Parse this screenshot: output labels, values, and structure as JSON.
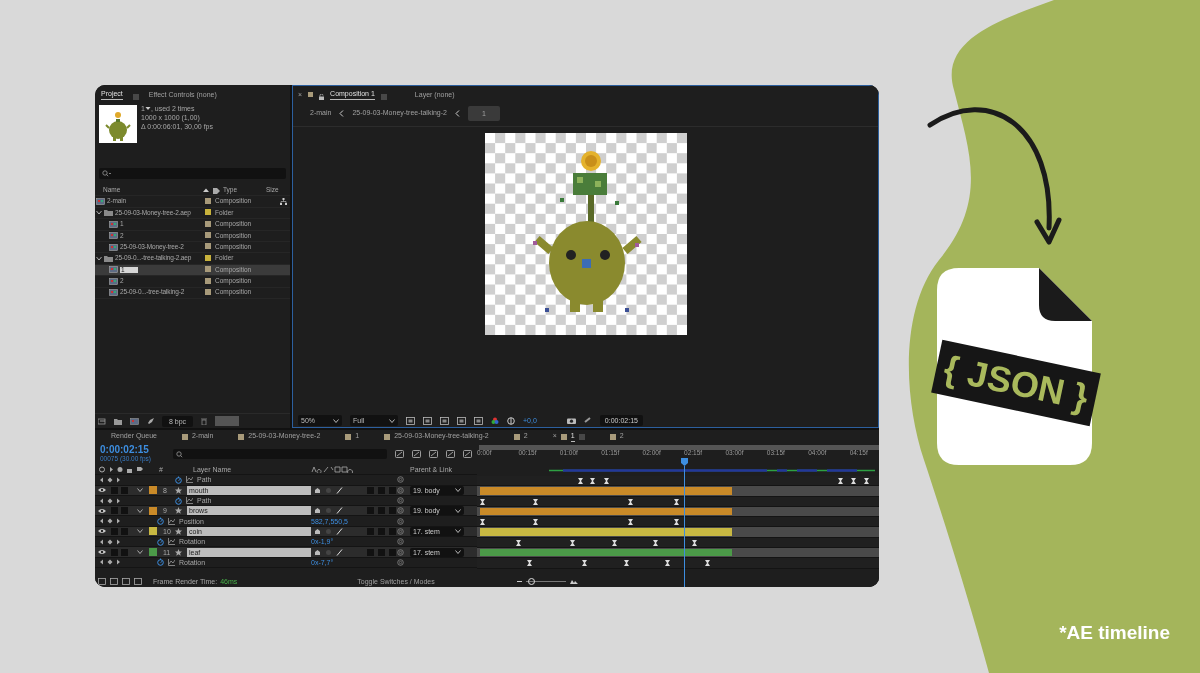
{
  "project_panel": {
    "tabs": [
      {
        "label": "Project",
        "selected": true
      },
      {
        "label": "Effect Controls (none)",
        "selected": false
      }
    ],
    "info": {
      "name": "1",
      "usage": ", used 2 times",
      "size": "1000 x 1000 (1,00)",
      "duration": "Δ 0:00:06:01, 30,00 fps"
    },
    "columns": [
      "Name",
      "Type",
      "Size"
    ],
    "items": [
      {
        "kind": "composition",
        "name": "2-main",
        "type": "Composition",
        "color": "#a89a7a",
        "selected": false
      },
      {
        "kind": "folder",
        "name": "25-09-03-Money-tree-2.aep",
        "type": "Folder",
        "color": "#c8b23c",
        "expanded": true,
        "selected": false,
        "children": [
          {
            "kind": "composition",
            "name": "1",
            "type": "Composition",
            "color": "#a89a7a",
            "selected": false
          },
          {
            "kind": "composition",
            "name": "2",
            "type": "Composition",
            "color": "#a89a7a",
            "selected": false
          },
          {
            "kind": "composition",
            "name": "25-09-03-Money-tree-2",
            "type": "Composition",
            "color": "#a89a7a",
            "selected": false
          }
        ]
      },
      {
        "kind": "folder",
        "name": "25-09-0...-tree-talking-2.aep",
        "type": "Folder",
        "color": "#c8b23c",
        "expanded": true,
        "selected": false,
        "children": [
          {
            "kind": "composition",
            "name": "1",
            "type": "Composition",
            "color": "#a89a7a",
            "selected": true
          },
          {
            "kind": "composition",
            "name": "2",
            "type": "Composition",
            "color": "#a89a7a",
            "selected": false
          },
          {
            "kind": "composition",
            "name": "25-09-0...-tree-talking-2",
            "type": "Composition",
            "color": "#a89a7a",
            "selected": false
          }
        ]
      }
    ],
    "bit_depth": "8 bpc"
  },
  "composition_panel": {
    "tabs": [
      {
        "label": "Composition 1",
        "selected": true
      },
      {
        "label": "Layer (none)",
        "selected": false
      }
    ],
    "breadcrumbs": [
      "2-main",
      "25-09-03-Money-tree-talking-2",
      "1"
    ],
    "close_label": "×",
    "zoom": "50%",
    "resolution": "Full",
    "exposure": "+0,0",
    "timecode": "0:00:02:15"
  },
  "timeline": {
    "tabs": [
      {
        "label": "Render Queue",
        "selected": false
      },
      {
        "label": "2-main",
        "color": "#a89a7a",
        "selected": false
      },
      {
        "label": "25-09-03-Money-tree-2",
        "color": "#a89a7a",
        "selected": false
      },
      {
        "label": "1",
        "color": "#a89a7a",
        "selected": false
      },
      {
        "label": "25-09-03-Money-tree-talking-2",
        "color": "#a89a7a",
        "selected": false
      },
      {
        "label": "2",
        "color": "#a89a7a",
        "selected": false
      },
      {
        "label": "1",
        "color": "#a89a7a",
        "selected": true,
        "close_label": "×"
      },
      {
        "label": "2",
        "color": "#a89a7a",
        "selected": false
      }
    ],
    "timecode": "0:00:02:15",
    "frame_info": "00075 (30.00 fps)",
    "columns": [
      "#",
      "Layer Name",
      "Parent & Link"
    ],
    "ruler": [
      "0:00f",
      "00:15f",
      "01:00f",
      "01:15f",
      "02:00f",
      "02:15f",
      "03:00f",
      "03:15f",
      "04:00f",
      "04:15f"
    ],
    "playhead": {
      "level": 0.515
    },
    "rows": [
      {
        "kind": "property",
        "name": "Path",
        "keyframes": [
          {
            "level": 0.249
          },
          {
            "level": 0.281
          },
          {
            "level": 0.314
          },
          {
            "level": 0.897
          },
          {
            "level": 0.93
          },
          {
            "level": 0.962
          }
        ]
      },
      {
        "kind": "layer",
        "number": "8",
        "name": "mouth",
        "color": "#c98a28",
        "parent": "19. body",
        "expanded": true,
        "level": 0.626
      },
      {
        "kind": "property",
        "name": "Path",
        "keyframes": [
          {
            "level": 0.005
          },
          {
            "level": 0.138
          },
          {
            "level": 0.374
          },
          {
            "level": 0.49
          }
        ]
      },
      {
        "kind": "layer",
        "number": "9",
        "name": "brows",
        "color": "#c98a28",
        "parent": "19. body",
        "expanded": true,
        "level": 0.626
      },
      {
        "kind": "property",
        "name": "Position",
        "value": "582,7,550,5",
        "keyframes": [
          {
            "level": 0.005
          },
          {
            "level": 0.138
          },
          {
            "level": 0.374
          },
          {
            "level": 0.49
          }
        ]
      },
      {
        "kind": "layer",
        "number": "10",
        "name": "coin",
        "color": "#c8b842",
        "parent": "17. stem",
        "expanded": true,
        "level": 0.626
      },
      {
        "kind": "property",
        "name": "Rotation",
        "value": "0x-1,9°",
        "keyframes": [
          {
            "level": 0.095
          },
          {
            "level": 0.231
          },
          {
            "level": 0.334
          },
          {
            "level": 0.437
          },
          {
            "level": 0.533
          }
        ]
      },
      {
        "kind": "layer",
        "number": "11",
        "name": "leaf",
        "color": "#4b9a48",
        "parent": "17. stem",
        "expanded": true,
        "level": 0.626
      },
      {
        "kind": "property",
        "name": "Rotation",
        "value": "0x-7,7°",
        "keyframes": [
          {
            "level": 0.123
          },
          {
            "level": 0.261
          },
          {
            "level": 0.364
          },
          {
            "level": 0.467
          },
          {
            "level": 0.565
          }
        ]
      }
    ],
    "render_time_label": "Frame Render Time:",
    "render_time": "46ms",
    "toggle_label": "Toggle Switches / Modes",
    "zoom_slider": {
      "level": 0.12
    }
  },
  "badge": {
    "label": "{ JSON }"
  },
  "caption": "*AE timeline"
}
